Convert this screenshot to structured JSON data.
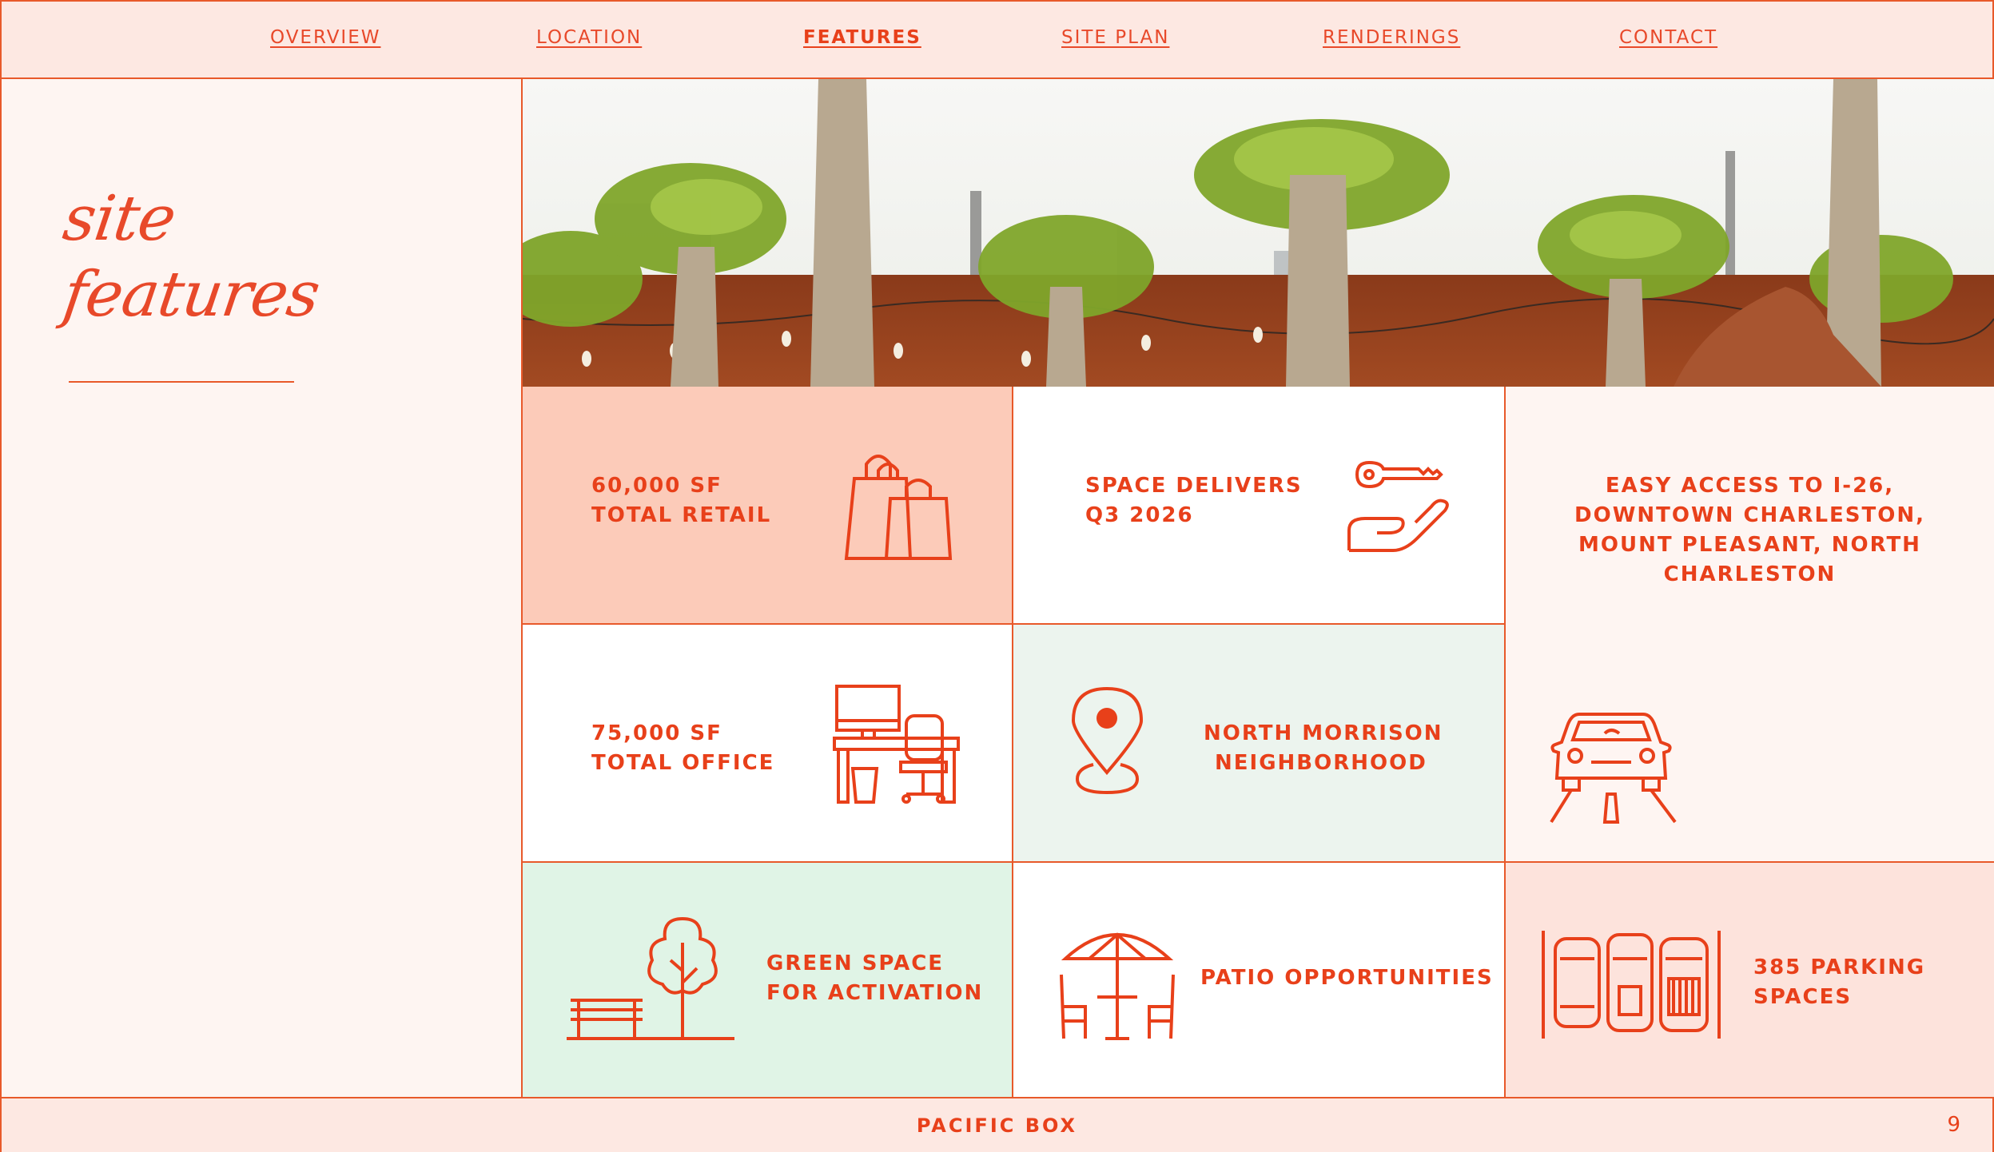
{
  "nav": {
    "items": [
      {
        "label": "OVERVIEW"
      },
      {
        "label": "LOCATION"
      },
      {
        "label": "FEATURES"
      },
      {
        "label": "SITE PLAN"
      },
      {
        "label": "RENDERINGS"
      },
      {
        "label": "CONTACT"
      }
    ],
    "active": "FEATURES"
  },
  "sidebar": {
    "title_line1": "site",
    "title_line2": "features"
  },
  "features": {
    "retail": {
      "line1": "60,000 SF",
      "line2": "TOTAL RETAIL",
      "icon": "shopping-bags-icon"
    },
    "delivery": {
      "line1": "SPACE DELIVERS",
      "line2": "Q3 2026",
      "icon": "key-in-hand-icon"
    },
    "access": {
      "line1": "EASY ACCESS TO I-26,",
      "line2": "DOWNTOWN CHARLESTON,",
      "line3": "MOUNT PLEASANT, NORTH",
      "line4": "CHARLESTON",
      "icon": "car-on-road-icon"
    },
    "office": {
      "line1": "75,000 SF",
      "line2": "TOTAL OFFICE",
      "icon": "office-desk-icon"
    },
    "neighborhood": {
      "line1": "NORTH MORRISON",
      "line2": "NEIGHBORHOOD",
      "icon": "location-pin-icon"
    },
    "green": {
      "line1": "GREEN SPACE",
      "line2": "FOR ACTIVATION",
      "icon": "tree-bench-icon"
    },
    "patio": {
      "line1": "PATIO OPPORTUNITIES",
      "icon": "patio-umbrella-icon"
    },
    "parking": {
      "line1": "385 PARKING",
      "line2": "SPACES",
      "icon": "parked-cars-icon"
    }
  },
  "footer": {
    "title": "PACIFIC BOX",
    "page_number": "9"
  },
  "colors": {
    "accent": "#e8401a",
    "retail_bg": "#fccbb9",
    "green_bg": "#e0f4e6",
    "neighborhood_bg": "#ecf4ee",
    "parking_bg": "#fde3dc",
    "panel_bg": "#fef5f2"
  }
}
